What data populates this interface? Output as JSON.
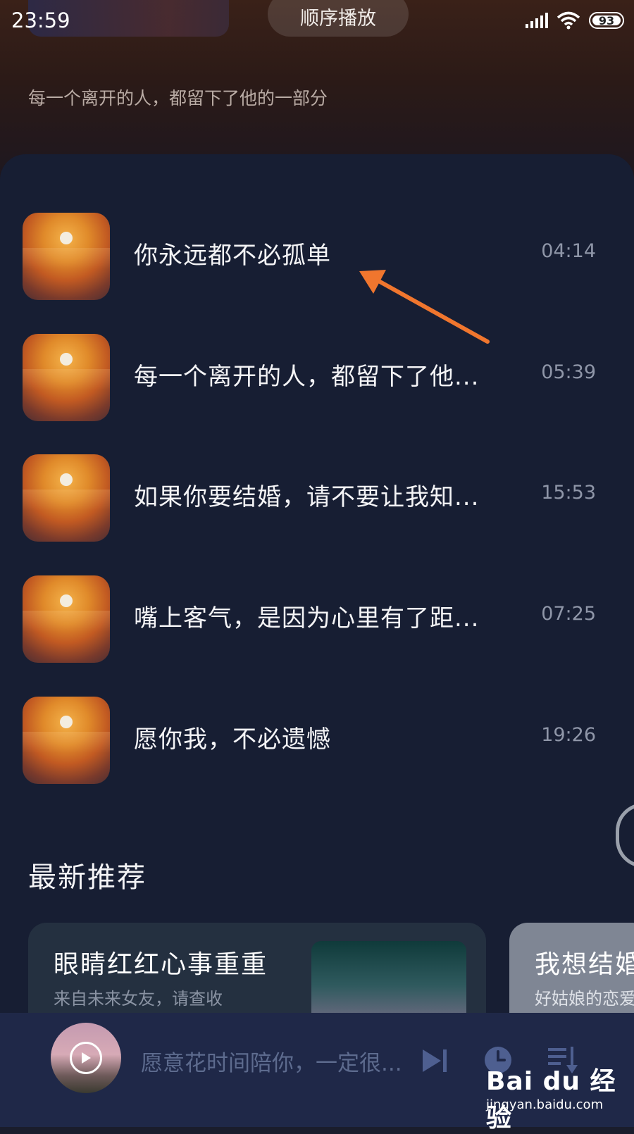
{
  "status_bar": {
    "time": "23:59",
    "battery": "93",
    "icons": [
      "signal-icon",
      "wifi-icon",
      "battery-icon"
    ]
  },
  "header": {
    "play_mode": "顺序播放",
    "subtitle": "每一个离开的人，都留下了他的一部分"
  },
  "tracks": [
    {
      "title": "你永远都不必孤单",
      "duration": "04:14"
    },
    {
      "title": "每一个离开的人，都留下了他...",
      "duration": "05:39"
    },
    {
      "title": "如果你要结婚，请不要让我知...",
      "duration": "15:53"
    },
    {
      "title": "嘴上客气，是因为心里有了距...",
      "duration": "07:25"
    },
    {
      "title": "愿你我，不必遗憾",
      "duration": "19:26"
    }
  ],
  "recommend": {
    "section_title": "最新推荐",
    "cards": [
      {
        "title": "眼睛红红心事重重",
        "subtitle": "来自未来女友，请查收"
      },
      {
        "title": "我想结婚",
        "subtitle": "好姑娘的恋爱"
      }
    ]
  },
  "player": {
    "now_playing": "愿意花时间陪你，一定很...",
    "controls": [
      "next-icon",
      "timer-icon",
      "playlist-icon"
    ]
  },
  "watermark": {
    "logo": "Bai du 经验",
    "url": "jingyan.baidu.com"
  },
  "colors": {
    "panel": "#171e33",
    "player": "#1f2848",
    "arrow": "#f0762e"
  }
}
